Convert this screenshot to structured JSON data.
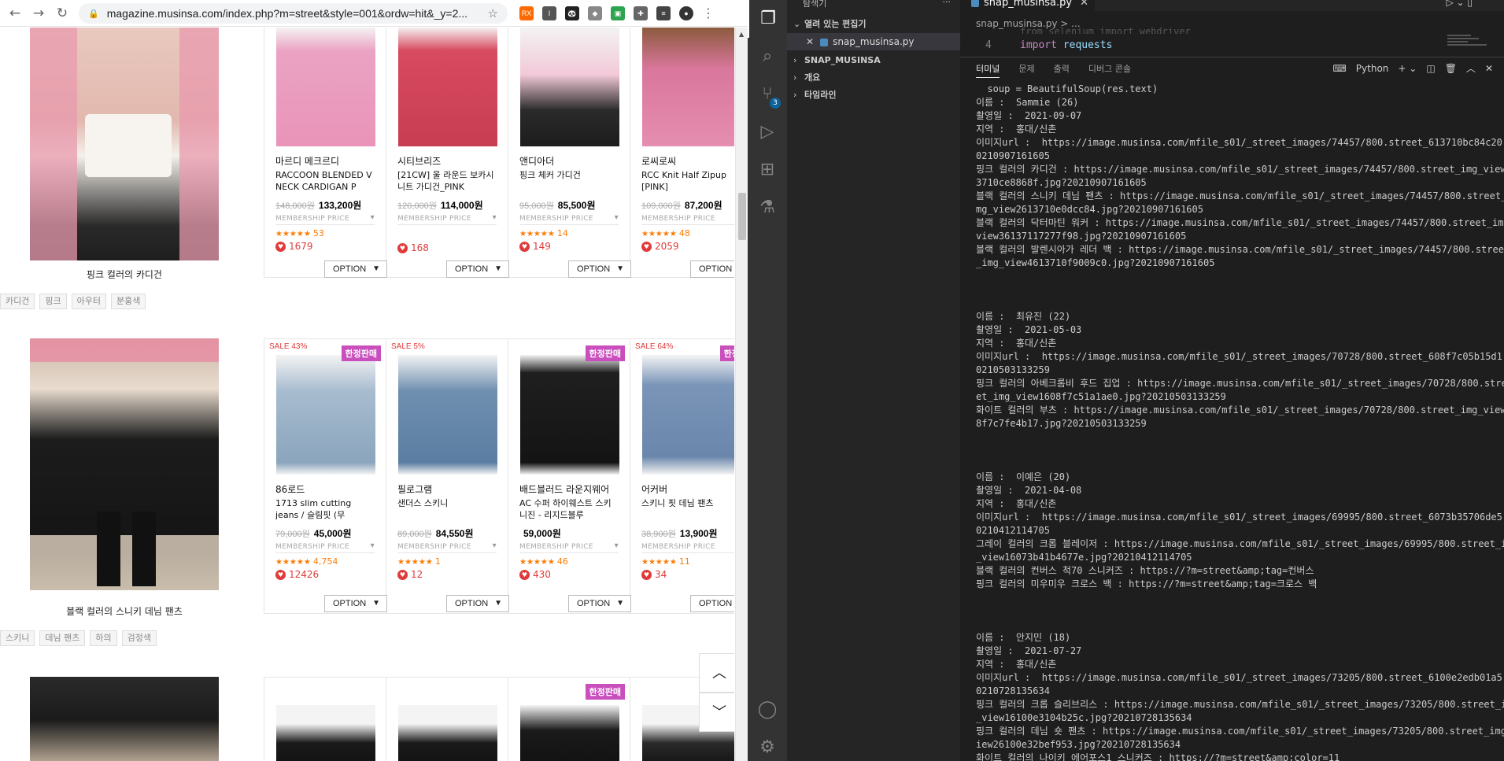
{
  "browser": {
    "url": "magazine.musinsa.com/index.php?m=street&style=001&ordw=hit&_y=2...",
    "extensions": [
      "RX",
      "I",
      "🐼",
      "◆",
      "▣",
      "✚",
      "≡",
      "●"
    ]
  },
  "sections": [
    {
      "caption": "핑크 컬러의 카디건",
      "tags": [
        "카디건",
        "핑크",
        "아우터",
        "분홍색"
      ],
      "products": [
        {
          "brand": "마르디 메크르디",
          "name": "RACCOON BLENDED V NECK CARDIGAN P",
          "orig": "148,000원",
          "price": "133,200원",
          "member": "MEMBERSHIP PRICE",
          "rating": "★★★★★",
          "reviews": "53",
          "likes": "1679",
          "sale": "",
          "badge": "",
          "option": "OPTION"
        },
        {
          "brand": "시티브리즈",
          "name": "[21CW] 울 라운드 보카시 니트 가디건_PINK",
          "orig": "120,000원",
          "price": "114,000원",
          "member": "MEMBERSHIP PRICE",
          "rating": "",
          "reviews": "",
          "likes": "168",
          "sale": "",
          "badge": "",
          "option": "OPTION"
        },
        {
          "brand": "앤디아더",
          "name": "핑크 체커 가디건",
          "orig": "95,000원",
          "price": "85,500원",
          "member": "MEMBERSHIP PRICE",
          "rating": "★★★★★",
          "reviews": "14",
          "likes": "149",
          "sale": "",
          "badge": "",
          "option": "OPTION"
        },
        {
          "brand": "로씨로씨",
          "name": "RCC Knit Half Zipup [PINK]",
          "orig": "109,000원",
          "price": "87,200원",
          "member": "MEMBERSHIP PRICE",
          "rating": "★★★★★",
          "reviews": "48",
          "likes": "2059",
          "sale": "",
          "badge": "",
          "option": "OPTION"
        }
      ]
    },
    {
      "caption": "블랙 컬러의 스니키 데님 팬츠",
      "tags": [
        "스키니",
        "데님 팬츠",
        "하의",
        "검정색"
      ],
      "products": [
        {
          "brand": "86로드",
          "name": "1713 slim cutting jeans / 슬림핏 (무",
          "orig": "79,000원",
          "price": "45,000원",
          "member": "MEMBERSHIP PRICE",
          "rating": "★★★★★",
          "reviews": "4,754",
          "likes": "12426",
          "sale": "SALE 43%",
          "badge": "한정판매",
          "option": "OPTION"
        },
        {
          "brand": "필로그램",
          "name": "샌더스 스키니",
          "orig": "89,000원",
          "price": "84,550원",
          "member": "MEMBERSHIP PRICE",
          "rating": "★★★★★",
          "reviews": "1",
          "likes": "12",
          "sale": "SALE 5%",
          "badge": "",
          "option": "OPTION"
        },
        {
          "brand": "배드블러드 라운지웨어",
          "name": "AC 수퍼 하이웨스트 스키니진 - 리지드블루",
          "orig": "",
          "price": "59,000원",
          "member": "MEMBERSHIP PRICE",
          "rating": "★★★★★",
          "reviews": "46",
          "likes": "430",
          "sale": "",
          "badge": "한정판매",
          "option": "OPTION"
        },
        {
          "brand": "어커버",
          "name": "스키니 핏 데님 팬츠",
          "orig": "38,900원",
          "price": "13,900원",
          "member": "MEMBERSHIP PRICE",
          "rating": "★★★★★",
          "reviews": "11",
          "likes": "34",
          "sale": "SALE 64%",
          "badge": "한정판",
          "option": "OPTION"
        }
      ]
    },
    {
      "badge3": "한정판매"
    }
  ],
  "vscode": {
    "explorer_title": "탐색기",
    "open_editors": "열려 있는 편집기",
    "open_file": "snap_musinsa.py",
    "project": "SNAP_MUSINSA",
    "outline": "개요",
    "timeline": "타임라인",
    "tab_file": "snap_musinsa.py",
    "breadcrumb": "snap_musinsa.py > ...",
    "code_ghost": "from selenium import webdriver",
    "code_line_num": "4",
    "code_kw": "import",
    "code_mod": "requests",
    "scm_count": "3",
    "panel_tabs": [
      "터미널",
      "문제",
      "출력",
      "디버그 콘솔"
    ],
    "terminal_shell": "Python",
    "terminal": "  soup = BeautifulSoup(res.text)\n이름 :  Sammie (26)\n촬영일 :  2021-09-07\n지역 :  홍대/신촌\n이미지url :  https://image.musinsa.com/mfile_s01/_street_images/74457/800.street_613710bc84c20.jpg?2\n0210907161605\n핑크 컬러의 카디건 : https://image.musinsa.com/mfile_s01/_street_images/74457/800.street_img_view161\n3710ce8868f.jpg?20210907161605\n블랙 컬러의 스니키 데님 팬츠 : https://image.musinsa.com/mfile_s01/_street_images/74457/800.street_i\nmg_view2613710e0dcc84.jpg?20210907161605\n블랙 컬러의 닥터마틴 워커 : https://image.musinsa.com/mfile_s01/_street_images/74457/800.street_img_\nview36137117277f98.jpg?20210907161605\n블랙 컬러의 발렌시아가 레더 백 : https://image.musinsa.com/mfile_s01/_street_images/74457/800.street\n_img_view4613710f9009c0.jpg?20210907161605\n\n\n\n이름 :  최유진 (22)\n촬영일 :  2021-05-03\n지역 :  홍대/신촌\n이미지url :  https://image.musinsa.com/mfile_s01/_street_images/70728/800.street_608f7c05b15d1.jpg?2\n0210503133259\n핑크 컬러의 아베크롬비 후드 집업 : https://image.musinsa.com/mfile_s01/_street_images/70728/800.stre\net_img_view1608f7c51a1ae0.jpg?20210503133259\n화이트 컬러의 부츠 : https://image.musinsa.com/mfile_s01/_street_images/70728/800.street_img_view260\n8f7c7fe4b17.jpg?20210503133259\n\n\n\n이름 :  이예은 (20)\n촬영일 :  2021-04-08\n지역 :  홍대/신촌\n이미지url :  https://image.musinsa.com/mfile_s01/_street_images/69995/800.street_6073b35706de5.jpg?2\n0210412114705\n그레이 컬러의 크롭 블레이저 : https://image.musinsa.com/mfile_s01/_street_images/69995/800.street_img\n_view16073b41b4677e.jpg?20210412114705\n블랙 컬러의 컨버스 척70 스니커즈 : https://?m=street&amp;tag=컨버스\n핑크 컬러의 미우미우 크로스 백 : https://?m=street&amp;tag=크로스 백\n\n\n\n이름 :  안지민 (18)\n촬영일 :  2021-07-27\n지역 :  홍대/신촌\n이미지url :  https://image.musinsa.com/mfile_s01/_street_images/73205/800.street_6100e2edb01a5.jpg?2\n0210728135634\n핑크 컬러의 크롭 슬리브리스 : https://image.musinsa.com/mfile_s01/_street_images/73205/800.street_img\n_view16100e3104b25c.jpg?20210728135634\n핑크 컬러의 데님 숏 팬츠 : https://image.musinsa.com/mfile_s01/_street_images/73205/800.street_img_v\niew26100e32bef953.jpg?20210728135634\n화이트 컬러의 나이키 에어포스1 스니커즈 : https://?m=street&amp;color=11"
  }
}
